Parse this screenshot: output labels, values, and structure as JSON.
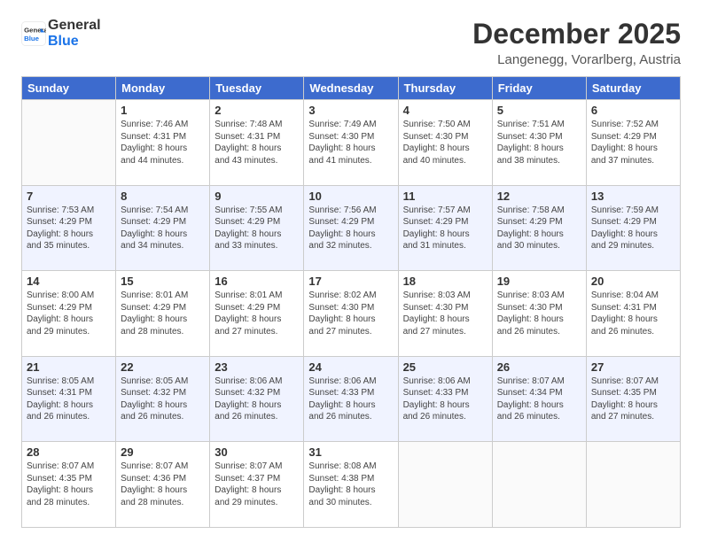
{
  "header": {
    "logo_line1": "General",
    "logo_line2": "Blue",
    "month": "December 2025",
    "location": "Langenegg, Vorarlberg, Austria"
  },
  "days_of_week": [
    "Sunday",
    "Monday",
    "Tuesday",
    "Wednesday",
    "Thursday",
    "Friday",
    "Saturday"
  ],
  "weeks": [
    [
      {
        "day": "",
        "content": ""
      },
      {
        "day": "1",
        "content": "Sunrise: 7:46 AM\nSunset: 4:31 PM\nDaylight: 8 hours\nand 44 minutes."
      },
      {
        "day": "2",
        "content": "Sunrise: 7:48 AM\nSunset: 4:31 PM\nDaylight: 8 hours\nand 43 minutes."
      },
      {
        "day": "3",
        "content": "Sunrise: 7:49 AM\nSunset: 4:30 PM\nDaylight: 8 hours\nand 41 minutes."
      },
      {
        "day": "4",
        "content": "Sunrise: 7:50 AM\nSunset: 4:30 PM\nDaylight: 8 hours\nand 40 minutes."
      },
      {
        "day": "5",
        "content": "Sunrise: 7:51 AM\nSunset: 4:30 PM\nDaylight: 8 hours\nand 38 minutes."
      },
      {
        "day": "6",
        "content": "Sunrise: 7:52 AM\nSunset: 4:29 PM\nDaylight: 8 hours\nand 37 minutes."
      }
    ],
    [
      {
        "day": "7",
        "content": "Sunrise: 7:53 AM\nSunset: 4:29 PM\nDaylight: 8 hours\nand 35 minutes."
      },
      {
        "day": "8",
        "content": "Sunrise: 7:54 AM\nSunset: 4:29 PM\nDaylight: 8 hours\nand 34 minutes."
      },
      {
        "day": "9",
        "content": "Sunrise: 7:55 AM\nSunset: 4:29 PM\nDaylight: 8 hours\nand 33 minutes."
      },
      {
        "day": "10",
        "content": "Sunrise: 7:56 AM\nSunset: 4:29 PM\nDaylight: 8 hours\nand 32 minutes."
      },
      {
        "day": "11",
        "content": "Sunrise: 7:57 AM\nSunset: 4:29 PM\nDaylight: 8 hours\nand 31 minutes."
      },
      {
        "day": "12",
        "content": "Sunrise: 7:58 AM\nSunset: 4:29 PM\nDaylight: 8 hours\nand 30 minutes."
      },
      {
        "day": "13",
        "content": "Sunrise: 7:59 AM\nSunset: 4:29 PM\nDaylight: 8 hours\nand 29 minutes."
      }
    ],
    [
      {
        "day": "14",
        "content": "Sunrise: 8:00 AM\nSunset: 4:29 PM\nDaylight: 8 hours\nand 29 minutes."
      },
      {
        "day": "15",
        "content": "Sunrise: 8:01 AM\nSunset: 4:29 PM\nDaylight: 8 hours\nand 28 minutes."
      },
      {
        "day": "16",
        "content": "Sunrise: 8:01 AM\nSunset: 4:29 PM\nDaylight: 8 hours\nand 27 minutes."
      },
      {
        "day": "17",
        "content": "Sunrise: 8:02 AM\nSunset: 4:30 PM\nDaylight: 8 hours\nand 27 minutes."
      },
      {
        "day": "18",
        "content": "Sunrise: 8:03 AM\nSunset: 4:30 PM\nDaylight: 8 hours\nand 27 minutes."
      },
      {
        "day": "19",
        "content": "Sunrise: 8:03 AM\nSunset: 4:30 PM\nDaylight: 8 hours\nand 26 minutes."
      },
      {
        "day": "20",
        "content": "Sunrise: 8:04 AM\nSunset: 4:31 PM\nDaylight: 8 hours\nand 26 minutes."
      }
    ],
    [
      {
        "day": "21",
        "content": "Sunrise: 8:05 AM\nSunset: 4:31 PM\nDaylight: 8 hours\nand 26 minutes."
      },
      {
        "day": "22",
        "content": "Sunrise: 8:05 AM\nSunset: 4:32 PM\nDaylight: 8 hours\nand 26 minutes."
      },
      {
        "day": "23",
        "content": "Sunrise: 8:06 AM\nSunset: 4:32 PM\nDaylight: 8 hours\nand 26 minutes."
      },
      {
        "day": "24",
        "content": "Sunrise: 8:06 AM\nSunset: 4:33 PM\nDaylight: 8 hours\nand 26 minutes."
      },
      {
        "day": "25",
        "content": "Sunrise: 8:06 AM\nSunset: 4:33 PM\nDaylight: 8 hours\nand 26 minutes."
      },
      {
        "day": "26",
        "content": "Sunrise: 8:07 AM\nSunset: 4:34 PM\nDaylight: 8 hours\nand 26 minutes."
      },
      {
        "day": "27",
        "content": "Sunrise: 8:07 AM\nSunset: 4:35 PM\nDaylight: 8 hours\nand 27 minutes."
      }
    ],
    [
      {
        "day": "28",
        "content": "Sunrise: 8:07 AM\nSunset: 4:35 PM\nDaylight: 8 hours\nand 28 minutes."
      },
      {
        "day": "29",
        "content": "Sunrise: 8:07 AM\nSunset: 4:36 PM\nDaylight: 8 hours\nand 28 minutes."
      },
      {
        "day": "30",
        "content": "Sunrise: 8:07 AM\nSunset: 4:37 PM\nDaylight: 8 hours\nand 29 minutes."
      },
      {
        "day": "31",
        "content": "Sunrise: 8:08 AM\nSunset: 4:38 PM\nDaylight: 8 hours\nand 30 minutes."
      },
      {
        "day": "",
        "content": ""
      },
      {
        "day": "",
        "content": ""
      },
      {
        "day": "",
        "content": ""
      }
    ]
  ]
}
